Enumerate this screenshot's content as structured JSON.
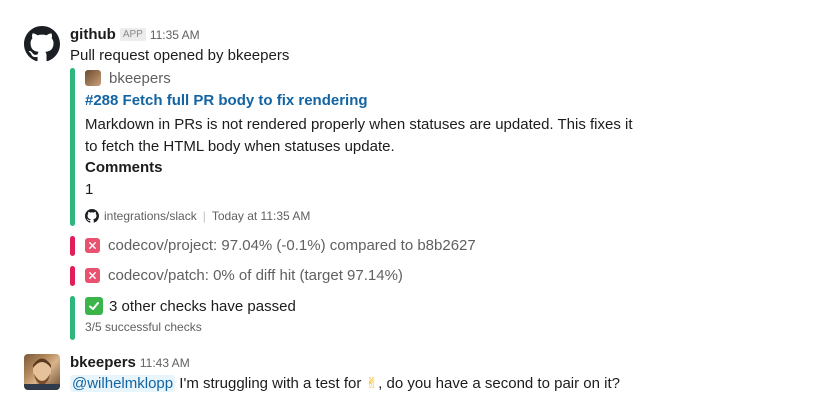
{
  "github_message": {
    "sender": "github",
    "badge": "APP",
    "time": "11:35 AM",
    "text": "Pull request opened by bkeepers",
    "attachment": {
      "author": "bkeepers",
      "title": "#288 Fetch full PR body to fix rendering",
      "description": "Markdown in PRs is not rendered properly when statuses are updated. This fixes it to fetch the HTML body when statuses update.",
      "field_title": "Comments",
      "field_value": "1",
      "footer_source": "integrations/slack",
      "footer_time": "Today at 11:35 AM"
    },
    "checks": [
      {
        "text": "codecov/project: 97.04% (-0.1%) compared to b8b2627",
        "status": "failed"
      },
      {
        "text": "codecov/patch: 0% of diff hit (target 97.14%)",
        "status": "failed"
      }
    ],
    "passed": {
      "text": "3 other checks have passed",
      "sub": "3/5 successful checks"
    }
  },
  "user_message": {
    "sender": "bkeepers",
    "time": "11:43 AM",
    "mention": "@wilhelmklopp",
    "text_before_emoji": "I'm struggling with a test for ",
    "emoji": "✌",
    "text_after_emoji": ", do you have a second to pair on it?"
  },
  "colors": {
    "accent_green": "#2eb67d",
    "accent_red": "#e01e5a",
    "link": "#1264a3"
  }
}
